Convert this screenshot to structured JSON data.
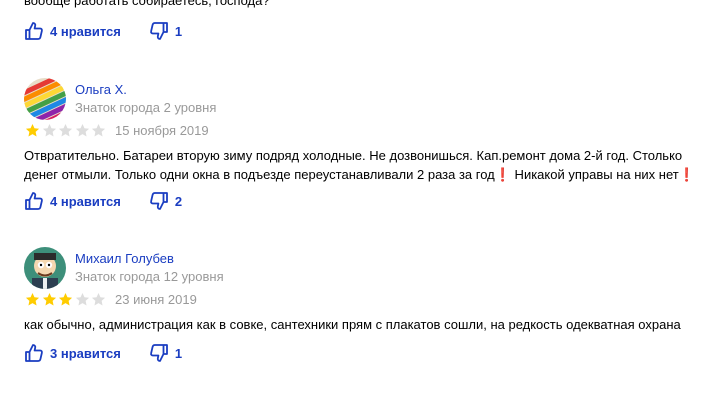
{
  "prev_review": {
    "text_tail": "вообще работать собираетесь, господа?",
    "likes_label": "4 нравится",
    "dislikes": "1"
  },
  "reviews": [
    {
      "author": "Ольга Х.",
      "level": "Знаток города 2 уровня",
      "rating": 1,
      "max_rating": 5,
      "date": "15 ноября 2019",
      "text": "Отвратительно. Батареи вторую зиму подряд холодные. Не дозвонишься. Кап.ремонт дома 2-й год. Столько денег отмыли. Только одни окна в подъезде переустанавливали 2 раза за год❗ Никакой управы на них нет❗",
      "likes_label": "4 нравится",
      "dislikes": "2"
    },
    {
      "author": "Михаил Голубев",
      "level": "Знаток города 12 уровня",
      "rating": 3,
      "max_rating": 5,
      "date": "23 июня 2019",
      "text": "как обычно, администрация как в совке, сантехники прям с плакатов сошли, на редкость одекватная охрана",
      "likes_label": "3 нравится",
      "dislikes": "1"
    }
  ],
  "colors": {
    "link": "#1a3dc1",
    "star_filled": "#ffcc00",
    "star_empty": "#dddddd",
    "muted": "#999999"
  }
}
